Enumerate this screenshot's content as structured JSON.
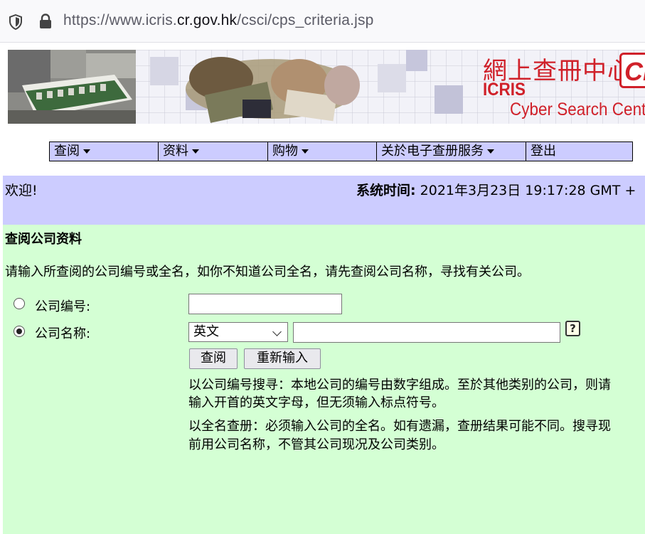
{
  "browser": {
    "url_prefix": "https://www.icris.",
    "url_domain": "cr.gov.hk",
    "url_path": "/csci/cps_criteria.jsp"
  },
  "banner": {
    "title_cn": "網上查冊中心",
    "title_en1": "ICRIS",
    "title_en2": "Cyber Search Centre",
    "logo_text": "CI"
  },
  "nav": {
    "items": [
      {
        "label": "查阅",
        "dropdown": true
      },
      {
        "label": "资料",
        "dropdown": true
      },
      {
        "label": "购物",
        "dropdown": true
      },
      {
        "label": "关於电子查册服务",
        "dropdown": true
      },
      {
        "label": "登出",
        "dropdown": false
      }
    ]
  },
  "header": {
    "welcome": "欢迎!",
    "time_label": "系统时间:",
    "time_value": " 2021年3月23日 19:17:28 GMT +"
  },
  "main": {
    "title": "查阅公司资料",
    "intro": "请输入所查阅的公司编号或全名，如你不知道公司全名，请先查阅公司名称，寻找有关公司。",
    "option_number_label": "公司编号:",
    "option_name_label": "公司名称:",
    "language_selected": "英文",
    "help_icon_text": "?",
    "search_button": "查阅",
    "reset_button": "重新输入",
    "note1_line1": "以公司编号搜寻：本地公司的编号由数字组成。至於其他类别的公司，则请",
    "note1_line2": "输入开首的英文字母，但无须输入标点符号。",
    "note2_line1": "以全名查册：必须输入公司的全名。如有遗漏，查册结果可能不同。搜寻现",
    "note2_line2": "前用公司名称，不管其公司现况及公司类别。"
  },
  "colors": {
    "nav_bg": "#ccccff",
    "content_bg": "#d4ffd4",
    "brand_red": "#d0212a"
  }
}
